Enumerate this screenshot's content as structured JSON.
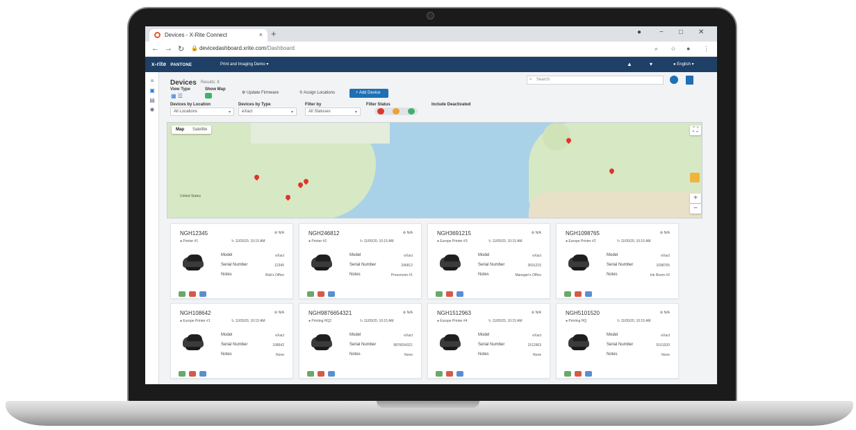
{
  "browser": {
    "tab_title": "Devices - X-Rite Connect",
    "tab_close": "×",
    "new_tab": "+",
    "url_host": "devicedashboard.xrite.com",
    "url_path": "/Dashboard"
  },
  "app": {
    "brand": "x-rite",
    "brand_sub": "PANTONE",
    "workspace": "Print and Imaging Demo",
    "language": "English"
  },
  "page": {
    "title": "Devices",
    "result_count": "Results: 8",
    "view_type_label": "View Type",
    "show_map_label": "Show Map",
    "update_firmware": "Update Firmware",
    "assign_locations": "Assign Locations",
    "add_device": "+ Add Device",
    "search_placeholder": "Search"
  },
  "filters": {
    "location_label": "Devices by Location",
    "location_value": "All Locations",
    "type_label": "Devices by Type",
    "type_value": "eXact",
    "filter_label": "Filter by",
    "filter_value": "All Statuses",
    "status_label": "Filter Status",
    "deactivated_label": "Include Deactivated",
    "status_colors": [
      "#e0352b",
      "#f0a030",
      "#3fb26a"
    ]
  },
  "map": {
    "tab_map": "Map",
    "tab_satellite": "Satellite",
    "zoom_in": "+",
    "zoom_out": "−",
    "labels": [
      "United States"
    ]
  },
  "devices": [
    {
      "id": "NGH12345",
      "status": "N/A",
      "name": "Printer #1",
      "date": "11/05/20, 10:15 AM",
      "model": "eXact",
      "serial": "12345",
      "notes": "Bob's Office"
    },
    {
      "id": "NGH246812",
      "status": "N/A",
      "name": "Printer #2",
      "date": "11/05/20, 10:15 AM",
      "model": "eXact",
      "serial": "246812",
      "notes": "Pressroom #1"
    },
    {
      "id": "NGH3691215",
      "status": "N/A",
      "name": "Europe Printer #3",
      "date": "11/05/20, 10:15 AM",
      "model": "eXact",
      "serial": "3691215",
      "notes": "Manager's Office"
    },
    {
      "id": "NGH1098765",
      "status": "N/A",
      "name": "Europe Printer #2",
      "date": "11/05/20, 10:15 AM",
      "model": "eXact",
      "serial": "1098765",
      "notes": "Ink Room #2"
    },
    {
      "id": "NGH108642",
      "status": "N/A",
      "name": "Europe Printer #1",
      "date": "11/05/20, 10:15 AM",
      "model": "eXact",
      "serial": "108642",
      "notes": "None"
    },
    {
      "id": "NGH9876654321",
      "status": "N/A",
      "name": "Printing HQ2",
      "date": "11/05/20, 10:15 AM",
      "model": "eXact",
      "serial": "9876654321",
      "notes": "None"
    },
    {
      "id": "NGH1512963",
      "status": "N/A",
      "name": "Europe Printer #4",
      "date": "11/05/20, 10:15 AM",
      "model": "eXact",
      "serial": "1512963",
      "notes": "None"
    },
    {
      "id": "NGH5101520",
      "status": "N/A",
      "name": "Printing HQ",
      "date": "11/05/20, 10:15 AM",
      "model": "eXact",
      "serial": "5101520",
      "notes": "None"
    }
  ],
  "attr_labels": {
    "model": "Model",
    "serial": "Serial Number",
    "notes": "Notes"
  }
}
